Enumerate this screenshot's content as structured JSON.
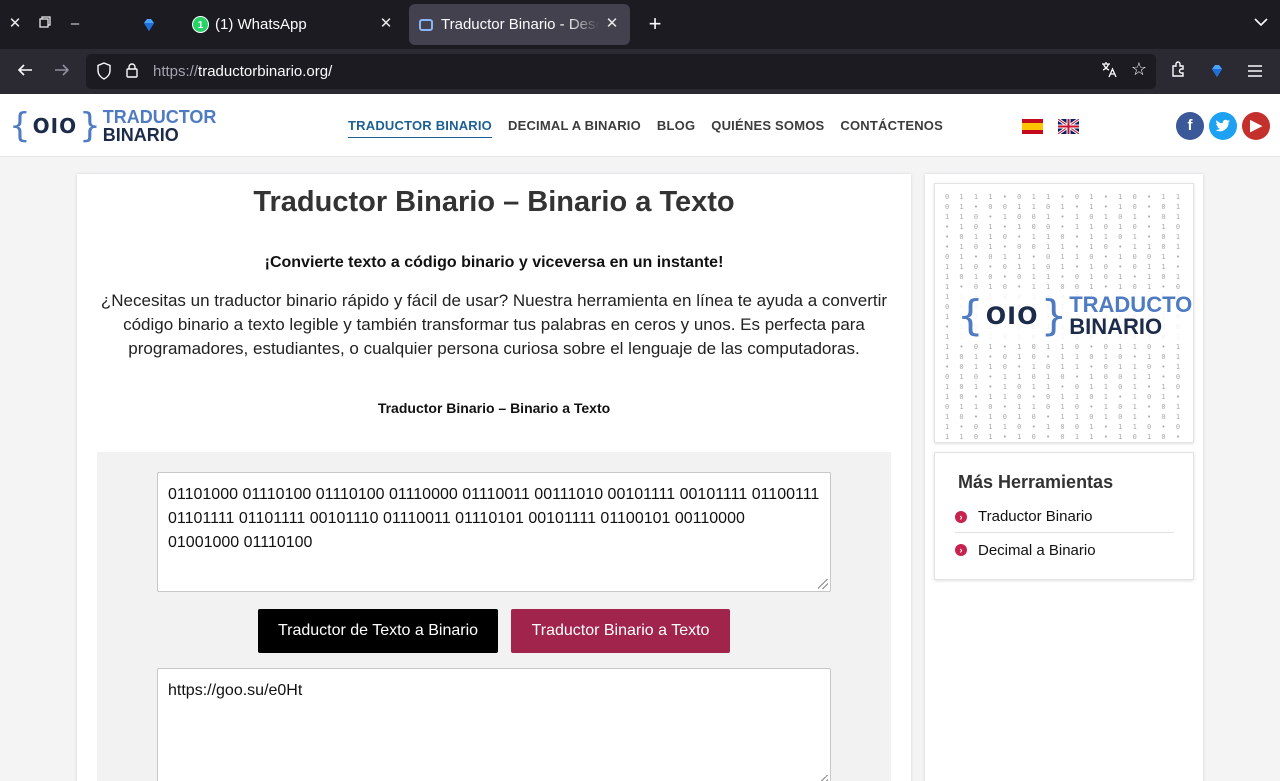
{
  "browser": {
    "tabs": [
      {
        "label": ""
      },
      {
        "label": "(1) WhatsApp",
        "badge": "1"
      },
      {
        "label": "Traductor Binario - Descifra"
      }
    ],
    "url_protocol": "https://",
    "url_domain": "traductorbinario.org/"
  },
  "site": {
    "logo_bits": "OIO",
    "logo_word1": "TRADUCTOR",
    "logo_word2": "BINARIO",
    "menu": [
      {
        "label": "TRADUCTOR BINARIO",
        "active": true
      },
      {
        "label": "DECIMAL A BINARIO"
      },
      {
        "label": "BLOG"
      },
      {
        "label": "QUIÉNES SOMOS"
      },
      {
        "label": "CONTÁCTENOS"
      }
    ],
    "social": {
      "facebook": "f",
      "twitter": "t",
      "youtube": "▶"
    }
  },
  "main": {
    "title": "Traductor Binario – Binario a Texto",
    "subhead": "¡Convierte texto a código binario y viceversa en un instante!",
    "intro": "¿Necesitas un traductor binario rápido y fácil de usar? Nuestra herramienta en línea te ayuda a convertir código binario a texto legible y también transformar tus palabras en ceros y unos. Es perfecta para programadores, estudiantes, o cualquier persona curiosa sobre el lenguaje de las computadoras.",
    "minor_title": "Traductor Binario – Binario a Texto",
    "input_value": "01101000 01110100 01110100 01110000 01110011 00111010 00101111 00101111 01100111 01101111 01101111 00101110 01110011 01110101 00101111 01100101 00110000 01001000 01110100",
    "btn_text_to_binary": "Traductor de Texto a Binario",
    "btn_binary_to_text": "Traductor Binario a Texto",
    "output_value": "https://goo.su/e0Ht"
  },
  "sidebar": {
    "more_tools_title": "Más Herramientas",
    "tools": [
      "Traductor Binario",
      "Decimal a Binario"
    ]
  },
  "colors": {
    "accent_blue": "#4e7bc2",
    "button_magenta": "#a1244c",
    "bullet_red": "#c8234f"
  }
}
